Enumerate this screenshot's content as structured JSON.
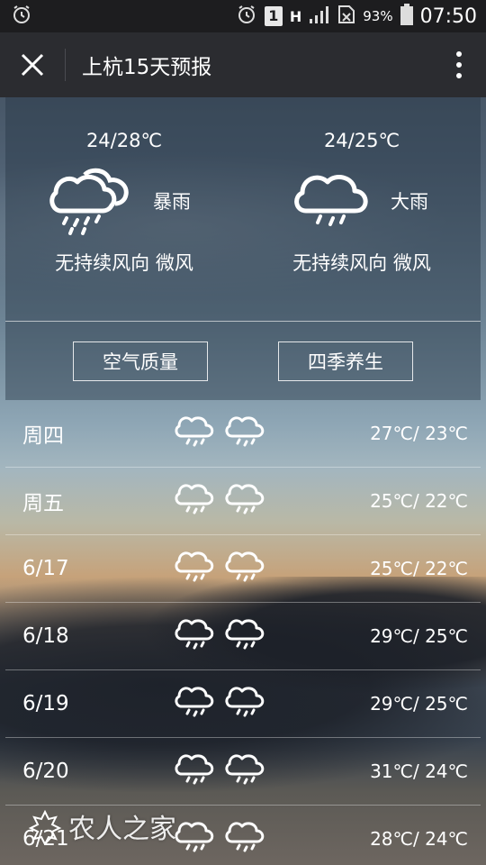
{
  "status_bar": {
    "battery_pct": "93%",
    "time": "07:50",
    "sim_badge": "1",
    "net_label": "H"
  },
  "app_bar": {
    "title": "上杭15天预报"
  },
  "today": [
    {
      "temp": "24/28℃",
      "condition": "暴雨",
      "wind": "无持续风向 微风",
      "icon": "heavy-rain-double-cloud-icon"
    },
    {
      "temp": "24/25℃",
      "condition": "大雨",
      "wind": "无持续风向 微风",
      "icon": "rain-cloud-icon"
    }
  ],
  "buttons": {
    "air_quality": "空气质量",
    "seasonal_health": "四季养生"
  },
  "forecast": [
    {
      "day": "周四",
      "temp": "27℃/ 23℃"
    },
    {
      "day": "周五",
      "temp": "25℃/ 22℃"
    },
    {
      "day": "6/17",
      "temp": "25℃/ 22℃"
    },
    {
      "day": "6/18",
      "temp": "29℃/ 25℃"
    },
    {
      "day": "6/19",
      "temp": "29℃/ 25℃"
    },
    {
      "day": "6/20",
      "temp": "31℃/ 24℃"
    },
    {
      "day": "6/21",
      "temp": "28℃/ 24℃"
    }
  ],
  "watermark": "农人之家"
}
